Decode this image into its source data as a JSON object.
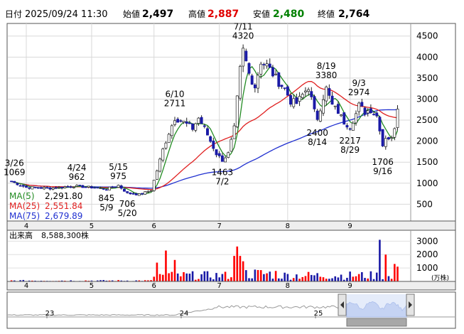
{
  "header": {
    "date_label": "日付",
    "datetime": "2025/09/24 11:30",
    "open_label": "始値",
    "open": "2,497",
    "high_label": "高値",
    "high": "2,887",
    "low_label": "安値",
    "low": "2,480",
    "close_label": "終値",
    "close": "2,764"
  },
  "colors": {
    "up": "#ff0000",
    "down": "#1a1aa6",
    "ma5": "#228b22",
    "ma25": "#e02020",
    "ma75": "#2030d0",
    "volume_up": "#ff0000",
    "volume_down": "#1a1aa6",
    "nav_fill": "#b8c8f0"
  },
  "legend": {
    "ma5_label": "MA(5)",
    "ma5_value": "2,291.80",
    "ma25_label": "MA(25)",
    "ma25_value": "2,551.84",
    "ma75_label": "MA(75)",
    "ma75_value": "2,679.89"
  },
  "volume": {
    "label": "出来高",
    "value": "8,588,300株",
    "unit": "(万株)"
  },
  "navigator": {
    "labels": [
      "23",
      "24",
      "25"
    ]
  },
  "chart_data": {
    "type": "candlestick",
    "y_ticks": [
      500,
      1000,
      1500,
      2000,
      2500,
      3000,
      3500,
      4000,
      4500
    ],
    "ylim": [
      100,
      4800
    ],
    "x_ticks": [
      {
        "label": "4",
        "day": 0
      },
      {
        "label": "5",
        "day": 22
      },
      {
        "label": "6",
        "day": 43
      },
      {
        "label": "7",
        "day": 65
      },
      {
        "label": "8",
        "day": 88
      },
      {
        "label": "9",
        "day": 109
      }
    ],
    "volume_ticks": [
      1000,
      2000,
      3000
    ],
    "volume_ylim": [
      0,
      3600
    ],
    "annotations": [
      {
        "date": "3/26",
        "value": "1069",
        "day": -4,
        "price": 1069,
        "pos": "above"
      },
      {
        "date": "4/24",
        "value": "962",
        "day": 17,
        "price": 962,
        "pos": "above"
      },
      {
        "date": "5/15",
        "value": "975",
        "day": 31,
        "price": 975,
        "pos": "above"
      },
      {
        "date": "5/9",
        "value": "845",
        "day": 27,
        "price": 845,
        "pos": "below"
      },
      {
        "date": "5/20",
        "value": "706",
        "day": 34,
        "price": 706,
        "pos": "below"
      },
      {
        "date": "6/10",
        "value": "2711",
        "day": 50,
        "price": 2711,
        "pos": "above"
      },
      {
        "date": "7/2",
        "value": "1463",
        "day": 66,
        "price": 1463,
        "pos": "below"
      },
      {
        "date": "7/11",
        "value": "4320",
        "day": 73,
        "price": 4320,
        "pos": "above"
      },
      {
        "date": "8/14",
        "value": "2400",
        "day": 98,
        "price": 2400,
        "pos": "below"
      },
      {
        "date": "8/19",
        "value": "3380",
        "day": 101,
        "price": 3380,
        "pos": "above"
      },
      {
        "date": "8/29",
        "value": "2217",
        "day": 109,
        "price": 2217,
        "pos": "below"
      },
      {
        "date": "9/3",
        "value": "2974",
        "day": 112,
        "price": 2974,
        "pos": "above"
      },
      {
        "date": "9/16",
        "value": "1706",
        "day": 120,
        "price": 1706,
        "pos": "below"
      }
    ],
    "anchors": [
      [
        -5,
        1040
      ],
      [
        0,
        900
      ],
      [
        8,
        880
      ],
      [
        16,
        930
      ],
      [
        22,
        900
      ],
      [
        27,
        860
      ],
      [
        31,
        950
      ],
      [
        34,
        760
      ],
      [
        38,
        730
      ],
      [
        42,
        830
      ],
      [
        44,
        1300
      ],
      [
        46,
        1800
      ],
      [
        48,
        2200
      ],
      [
        50,
        2550
      ],
      [
        53,
        2450
      ],
      [
        56,
        2300
      ],
      [
        58,
        2550
      ],
      [
        60,
        2300
      ],
      [
        62,
        2000
      ],
      [
        64,
        1700
      ],
      [
        66,
        1550
      ],
      [
        68,
        1700
      ],
      [
        70,
        2300
      ],
      [
        71,
        3000
      ],
      [
        72,
        3700
      ],
      [
        73,
        4150
      ],
      [
        75,
        3600
      ],
      [
        77,
        3300
      ],
      [
        79,
        3900
      ],
      [
        81,
        3800
      ],
      [
        83,
        3600
      ],
      [
        85,
        3400
      ],
      [
        87,
        3250
      ],
      [
        89,
        2950
      ],
      [
        91,
        2900
      ],
      [
        93,
        3100
      ],
      [
        95,
        3300
      ],
      [
        97,
        2700
      ],
      [
        98,
        2550
      ],
      [
        100,
        3050
      ],
      [
        101,
        3250
      ],
      [
        103,
        2850
      ],
      [
        105,
        2700
      ],
      [
        107,
        2450
      ],
      [
        109,
        2350
      ],
      [
        111,
        2650
      ],
      [
        112,
        2850
      ],
      [
        114,
        2700
      ],
      [
        116,
        2750
      ],
      [
        118,
        2600
      ],
      [
        119,
        2300
      ],
      [
        120,
        1900
      ],
      [
        121,
        2100
      ],
      [
        123,
        2050
      ],
      [
        124,
        2350
      ],
      [
        125,
        2764
      ]
    ],
    "volume_highlights": [
      {
        "day": 44,
        "value": 1400
      },
      {
        "day": 47,
        "value": 2300
      },
      {
        "day": 50,
        "value": 1600
      },
      {
        "day": 70,
        "value": 1900
      },
      {
        "day": 71,
        "value": 2600
      },
      {
        "day": 72,
        "value": 1900
      },
      {
        "day": 73,
        "value": 1500
      },
      {
        "day": 119,
        "value": 3100
      },
      {
        "day": 121,
        "value": 2000
      },
      {
        "day": 124,
        "value": 1300
      },
      {
        "day": 125,
        "value": 1100
      }
    ]
  }
}
